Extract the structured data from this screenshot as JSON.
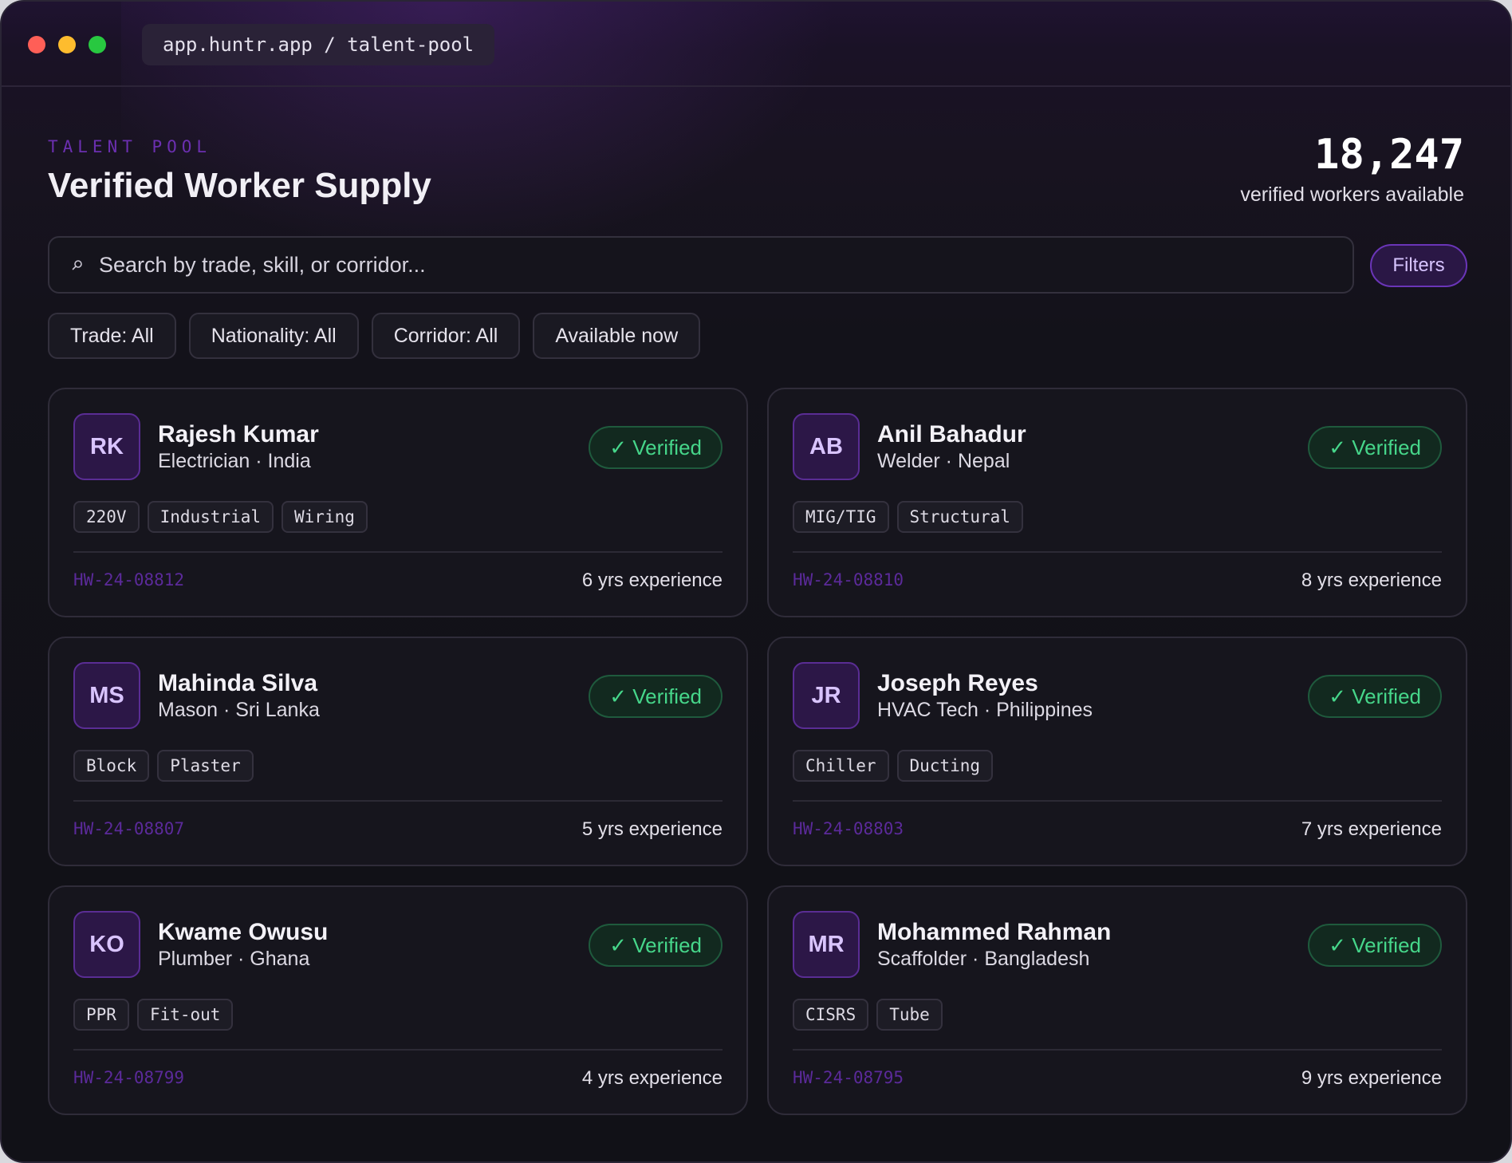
{
  "window": {
    "url": "app.huntr.app / talent-pool"
  },
  "header": {
    "eyebrow": "TALENT POOL",
    "title": "Verified Worker Supply",
    "stat_value": "18,247",
    "stat_label": "verified workers available"
  },
  "search": {
    "placeholder": "Search by trade, skill, or corridor...",
    "icon": "search-icon"
  },
  "filters_button": "Filters",
  "chips": [
    "Trade: All",
    "Nationality: All",
    "Corridor: All",
    "Available now"
  ],
  "workers": [
    {
      "initials": "RK",
      "name": "Rajesh Kumar",
      "subtitle": "Electrician · India",
      "badge": "✓ Verified",
      "tags": [
        "220V",
        "Industrial",
        "Wiring"
      ],
      "id": "HW-24-08812",
      "experience": "6 yrs experience"
    },
    {
      "initials": "AB",
      "name": "Anil Bahadur",
      "subtitle": "Welder · Nepal",
      "badge": "✓ Verified",
      "tags": [
        "MIG/TIG",
        "Structural"
      ],
      "id": "HW-24-08810",
      "experience": "8 yrs experience"
    },
    {
      "initials": "MS",
      "name": "Mahinda Silva",
      "subtitle": "Mason · Sri Lanka",
      "badge": "✓ Verified",
      "tags": [
        "Block",
        "Plaster"
      ],
      "id": "HW-24-08807",
      "experience": "5 yrs experience"
    },
    {
      "initials": "JR",
      "name": "Joseph Reyes",
      "subtitle": "HVAC Tech · Philippines",
      "badge": "✓ Verified",
      "tags": [
        "Chiller",
        "Ducting"
      ],
      "id": "HW-24-08803",
      "experience": "7 yrs experience"
    },
    {
      "initials": "KO",
      "name": "Kwame Owusu",
      "subtitle": "Plumber · Ghana",
      "badge": "✓ Verified",
      "tags": [
        "PPR",
        "Fit-out"
      ],
      "id": "HW-24-08799",
      "experience": "4 yrs experience"
    },
    {
      "initials": "MR",
      "name": "Mohammed Rahman",
      "subtitle": "Scaffolder · Bangladesh",
      "badge": "✓ Verified",
      "tags": [
        "CISRS",
        "Tube"
      ],
      "id": "HW-24-08795",
      "experience": "9 yrs experience"
    }
  ],
  "colors": {
    "accent": "#6b2fb0",
    "verified": "#46d68a",
    "background": "#111117"
  }
}
